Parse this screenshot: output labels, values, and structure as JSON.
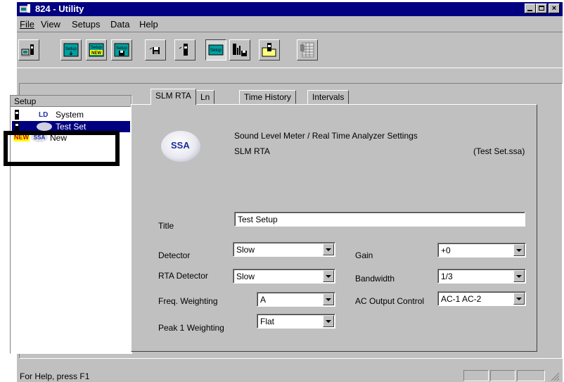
{
  "window": {
    "title": "824 - Utility",
    "controls": [
      "minimize",
      "restore",
      "close"
    ]
  },
  "menu": [
    "File",
    "View",
    "Setups",
    "Data",
    "Help"
  ],
  "toolbar": {
    "buttons": [
      {
        "name": "connect-meter",
        "icon": "computer-meter-icon",
        "label": ""
      },
      {
        "name": "setup",
        "icon": "setup-icon",
        "label": "Setup"
      },
      {
        "name": "setup-new",
        "icon": "setup-new-icon",
        "label": "Setup NEW"
      },
      {
        "name": "setup-save",
        "icon": "setup-save-icon",
        "label": "Setup"
      },
      {
        "name": "save-to-meter",
        "icon": "save-meter-icon",
        "label": ""
      },
      {
        "name": "meter",
        "icon": "meter-icon",
        "label": ""
      },
      {
        "name": "setup-active",
        "icon": "setup-active-icon",
        "label": "Setup"
      },
      {
        "name": "data-save",
        "icon": "data-save-icon",
        "label": ""
      },
      {
        "name": "open-file",
        "icon": "open-folder-icon",
        "label": ""
      },
      {
        "name": "spreadsheet",
        "icon": "spreadsheet-icon",
        "label": ""
      }
    ]
  },
  "tree": {
    "header": "Setup",
    "items": [
      {
        "label": "System",
        "badge": "LD",
        "selected": false
      },
      {
        "label": "Test Set",
        "badge": "SSA",
        "selected": true
      },
      {
        "label": "New",
        "badge": "SSA",
        "prefix": "NEW",
        "selected": false
      }
    ]
  },
  "tabs": [
    "SLM RTA",
    "Ln",
    "Time History",
    "Intervals"
  ],
  "active_tab": "SLM RTA",
  "panel": {
    "logo_text": "SSA",
    "heading": "Sound Level Meter / Real Time Analyzer Settings",
    "subheading": "SLM RTA",
    "file": "(Test Set.ssa)",
    "title_label": "Title",
    "title_value": "Test Setup",
    "detector_label": "Detector",
    "detector_value": "Slow",
    "rta_detector_label": "RTA Detector",
    "rta_detector_value": "Slow",
    "freq_weighting_label": "Freq. Weighting",
    "freq_weighting_value": "A",
    "peak1_weighting_label": "Peak 1 Weighting",
    "peak1_weighting_value": "Flat",
    "gain_label": "Gain",
    "gain_value": "+0",
    "bandwidth_label": "Bandwidth",
    "bandwidth_value": "1/3",
    "ac_output_label": "AC Output Control",
    "ac_output_value": "AC-1 AC-2"
  },
  "status": {
    "text": "For Help, press F1"
  },
  "colors": {
    "titlebar": "#000080",
    "face": "#c0c0c0",
    "selection": "#000080",
    "ssa_logo_text": "#1a2a9a"
  }
}
